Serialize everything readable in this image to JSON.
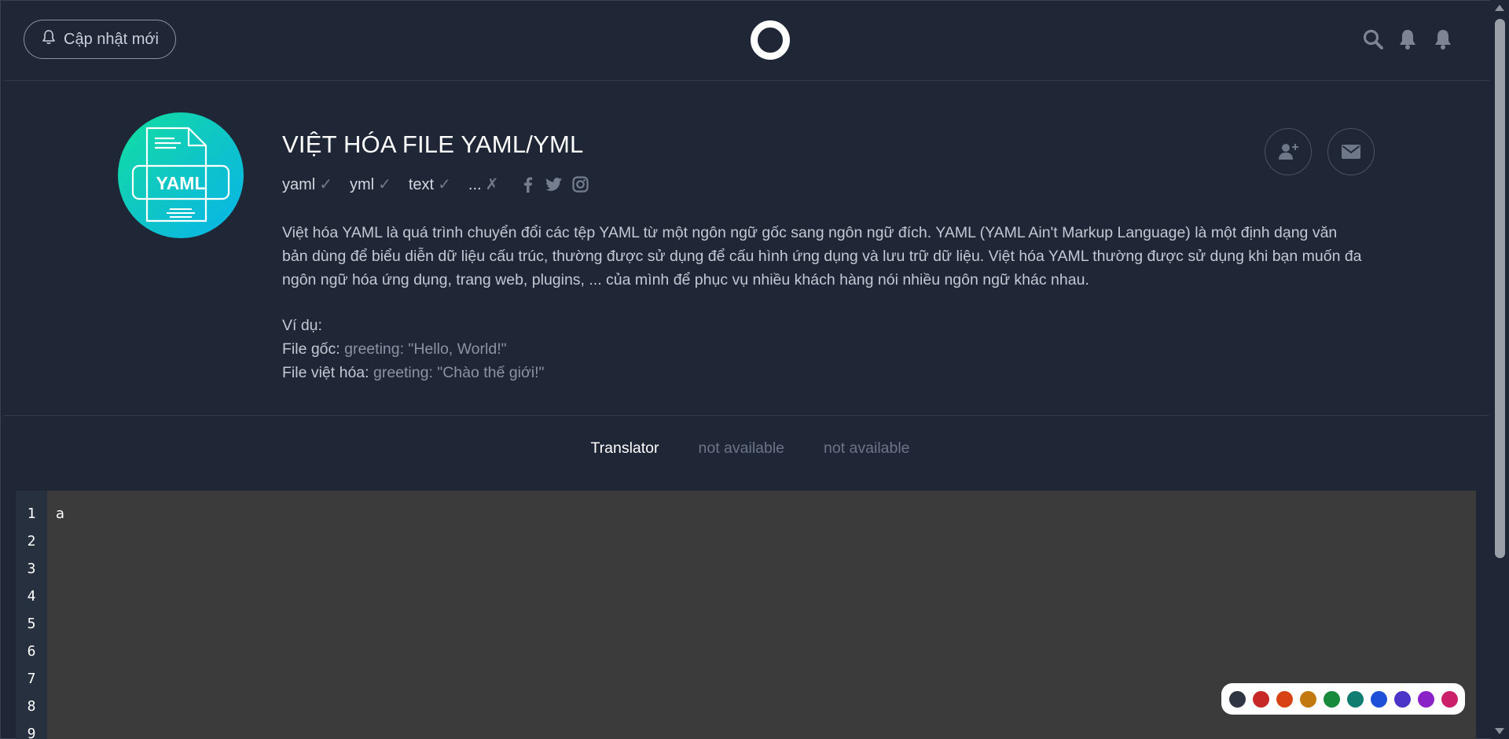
{
  "header": {
    "update_label": "Cập nhật mới",
    "icons": [
      "bell-icon",
      "logo-ring",
      "search-icon",
      "notification-bell-icon",
      "notification-bell-icon"
    ]
  },
  "profile": {
    "avatar_label": "YAML",
    "title": "VIỆT HÓA FILE YAML/YML",
    "tags": [
      {
        "label": "yaml",
        "mark": "✓"
      },
      {
        "label": "yml",
        "mark": "✓"
      },
      {
        "label": "text",
        "mark": "✓"
      },
      {
        "label": "...",
        "mark": "✗"
      }
    ],
    "social": [
      "facebook-icon",
      "twitter-icon",
      "instagram-icon"
    ],
    "description": "Việt hóa YAML là quá trình chuyển đổi các tệp YAML từ một ngôn ngữ gốc sang ngôn ngữ đích. YAML (YAML Ain't Markup Language) là một định dạng văn bản dùng để biểu diễn dữ liệu cấu trúc, thường được sử dụng để cấu hình ứng dụng và lưu trữ dữ liệu. Việt hóa YAML thường được sử dụng khi bạn muốn đa ngôn ngữ hóa ứng dụng, trang web, plugins, ... của mình để phục vụ nhiều khách hàng nói nhiều ngôn ngữ khác nhau.",
    "example_label": "Ví dụ:",
    "original_label": "File gốc:",
    "original_code": "greeting: \"Hello, World!\"",
    "translated_label": "File việt hóa:",
    "translated_code": "greeting: \"Chào thế giới!\""
  },
  "tabs": [
    "Translator",
    "not available",
    "not available"
  ],
  "editor": {
    "line_numbers": [
      "1",
      "2",
      "3",
      "4",
      "5",
      "6",
      "7",
      "8",
      "9"
    ],
    "first_line": "a"
  },
  "palette": [
    "#2f3542",
    "#c62828",
    "#d84315",
    "#c27a10",
    "#188a3c",
    "#0f7d72",
    "#1e4fd8",
    "#4a35c8",
    "#8b22c8",
    "#cc1f6a"
  ]
}
